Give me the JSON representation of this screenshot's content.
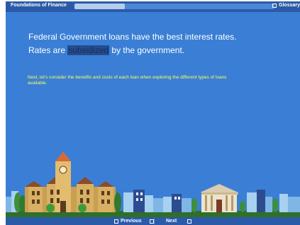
{
  "header": {
    "course_title": "Foundations of Finance",
    "progress_fraction": 0.25,
    "glossary_label": "Glossary"
  },
  "main": {
    "headline_line1": "Federal Government loans have the best interest rates.",
    "headline_line2_before": "Rates are ",
    "headline_line2_highlight": "subsidized",
    "headline_line2_after": " by the government.",
    "note": "Next, let's consider the benefits and costs of each loan when exploring the different types of loans available."
  },
  "footer": {
    "previous_label": "Previous",
    "next_label": "Next"
  },
  "colors": {
    "background": "#3a7fd5",
    "bar": "#2b5aa8",
    "note_text": "#ffff58"
  }
}
